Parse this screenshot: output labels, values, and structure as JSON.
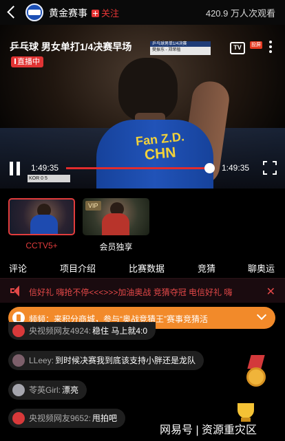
{
  "header": {
    "back_icon": "back-arrow-icon",
    "channel_name": "黄金赛事",
    "follow_label": "关注",
    "viewers": "420.9 万人次观看"
  },
  "player": {
    "title": "乒乓球 男女单打1/4决赛早场",
    "live_label": "直播中",
    "scorebug_line1": "乒乓球男单1/4决赛",
    "scorebug_line2": "樊振东 - 郑荣植",
    "tv_label": "TV",
    "tv_badge": "投屏",
    "jersey_name": "Fan Z.D.",
    "jersey_country": "CHN",
    "mini_score": "KOR  0  5",
    "time_current": "1:49:35",
    "time_total": "1:49:35",
    "progress_fraction": 0.99
  },
  "channels": [
    {
      "label": "CCTV5+",
      "active": true,
      "vip": ""
    },
    {
      "label": "会员独享",
      "active": false,
      "vip": "VIP"
    }
  ],
  "tabs": [
    "评论",
    "项目介绍",
    "比赛数据",
    "竞猜",
    "聊奥运"
  ],
  "ticker": {
    "text": "信好礼 嗨抢不停<<<>>>加油奥战 竞猜夺冠 电信好礼 嗨",
    "close_icon": "close-icon"
  },
  "pinned": {
    "text": "频频：来积分商城，参与“奥战竞猜王”赛事竞猜活"
  },
  "comments": [
    {
      "name": "央视频网友4924:",
      "text": "稳住 马上就4:0"
    },
    {
      "name": "LLeey:",
      "text": "到时候决赛我到底该支持小胖还是龙队"
    },
    {
      "name": "苓英Girl:",
      "text": "漂亮"
    },
    {
      "name": "央视频网友9652:",
      "text": "甩拍吧"
    }
  ],
  "watermark": "网易号 | 资源重灾区",
  "colors": {
    "accent": "#e23c3c",
    "pinned_bg": "#f28a2a",
    "comment_bg": "#1f1f1f"
  }
}
